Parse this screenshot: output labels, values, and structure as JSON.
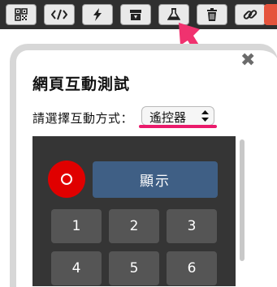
{
  "toolbar": {
    "buttons": [
      {
        "icon": "qr-code-icon"
      },
      {
        "icon": "code-icon"
      },
      {
        "icon": "lightning-icon"
      },
      {
        "icon": "archive-box-icon"
      },
      {
        "icon": "flask-icon"
      },
      {
        "icon": "trash-icon"
      },
      {
        "icon": "link-icon"
      }
    ]
  },
  "panel": {
    "title": "網頁互動測試",
    "close_label": "✖",
    "mode_label": "請選擇互動方式：",
    "mode_value": "遙控器"
  },
  "remote": {
    "display_label": "顯示",
    "keys": [
      "1",
      "2",
      "3",
      "4",
      "5",
      "6"
    ]
  },
  "colors": {
    "accent_pink": "#ea1a6b",
    "record_red": "#e00000",
    "display_blue": "#3f5f85"
  }
}
